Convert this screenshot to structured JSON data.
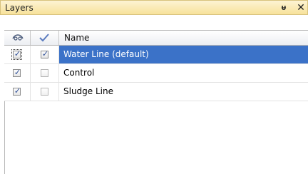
{
  "panel": {
    "title": "Layers",
    "pin_icon": "pin-icon",
    "close_icon": "close-icon"
  },
  "grid": {
    "columns": [
      {
        "icon": "eye-icon",
        "label": ""
      },
      {
        "icon": "checkmark-icon",
        "label": ""
      },
      {
        "label": "Name"
      }
    ],
    "rows": [
      {
        "visible": true,
        "active": true,
        "name": "Water Line (default)",
        "selected": true
      },
      {
        "visible": true,
        "active": false,
        "name": "Control",
        "selected": false
      },
      {
        "visible": true,
        "active": false,
        "name": "Sludge Line",
        "selected": false
      }
    ]
  },
  "colors": {
    "title_bar": "#f7e29a",
    "selection": "#3b72c8",
    "checkmark": "#2b4c96"
  }
}
